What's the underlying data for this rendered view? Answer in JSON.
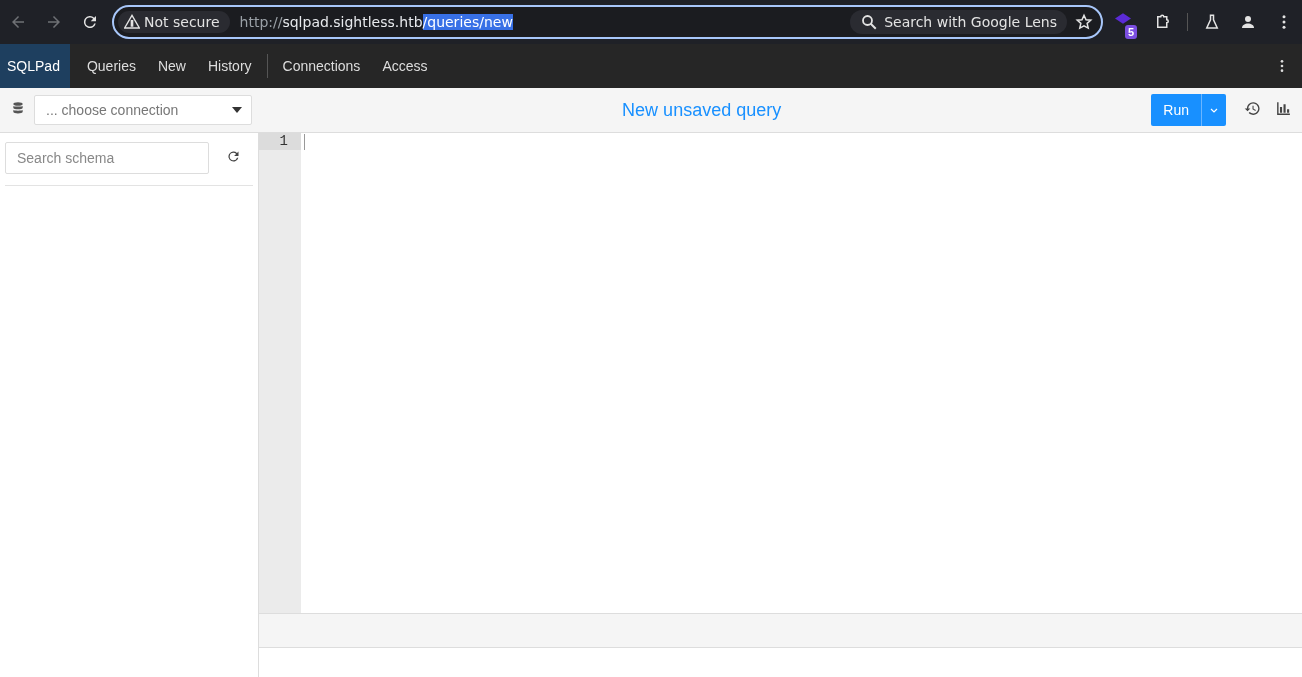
{
  "browser": {
    "security_label": "Not secure",
    "url": {
      "scheme": "http://",
      "host": "sqlpad.sightless.htb",
      "path": "/queries/new",
      "path_selected": true
    },
    "lens_label": "Search with Google Lens",
    "extension_badge": "5"
  },
  "app_nav": {
    "brand": "SQLPad",
    "groups": [
      [
        "Queries",
        "New",
        "History"
      ],
      [
        "Connections",
        "Access"
      ]
    ]
  },
  "toolbar": {
    "connection_placeholder": "... choose connection",
    "query_title": "New unsaved query",
    "run_label": "Run"
  },
  "sidebar": {
    "search_placeholder": "Search schema"
  },
  "editor": {
    "line_numbers": [
      {
        "label": "1",
        "selected": true
      }
    ]
  }
}
